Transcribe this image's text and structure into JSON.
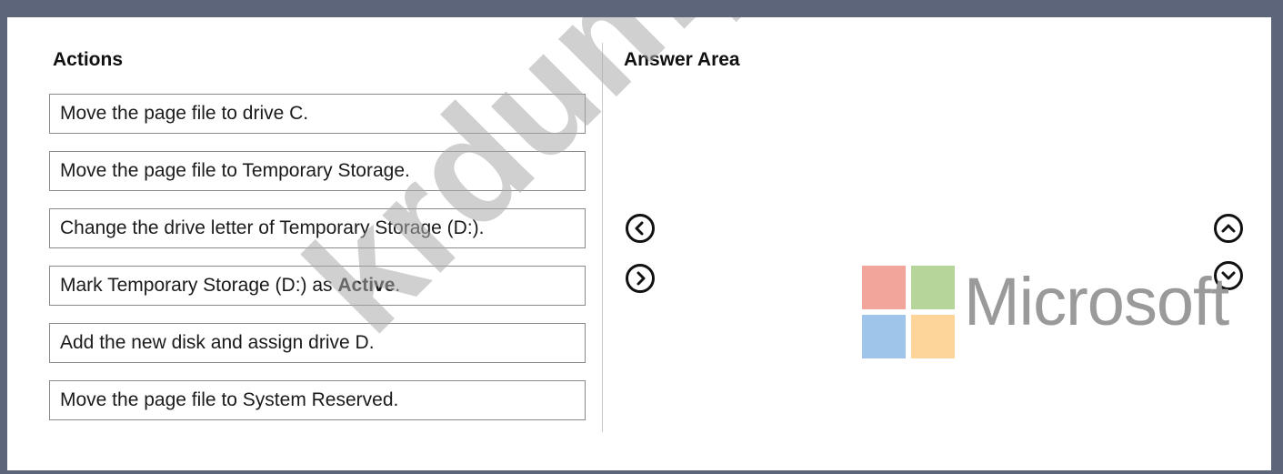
{
  "actions_heading": "Actions",
  "answer_heading": "Answer Area",
  "actions": [
    {
      "text": "Move the page file to drive C."
    },
    {
      "text": "Move the page file to Temporary Storage."
    },
    {
      "text": "Change the drive letter of Temporary Storage (D:)."
    },
    {
      "prefix": "Mark Temporary Storage (D:) as ",
      "bold": "Active",
      "suffix": "."
    },
    {
      "text": "Add the new disk and assign drive D."
    },
    {
      "text": "Move the page file to System Reserved."
    }
  ],
  "icons": {
    "move_left": "chevron-left-circle-icon",
    "move_right": "chevron-right-circle-icon",
    "move_up": "chevron-up-circle-icon",
    "move_down": "chevron-down-circle-icon"
  },
  "logo": {
    "text": "Microsoft",
    "colors": [
      "#f1a59b",
      "#b5d59a",
      "#9fc6ea",
      "#fdd49a"
    ]
  },
  "watermark": "krdump.com"
}
